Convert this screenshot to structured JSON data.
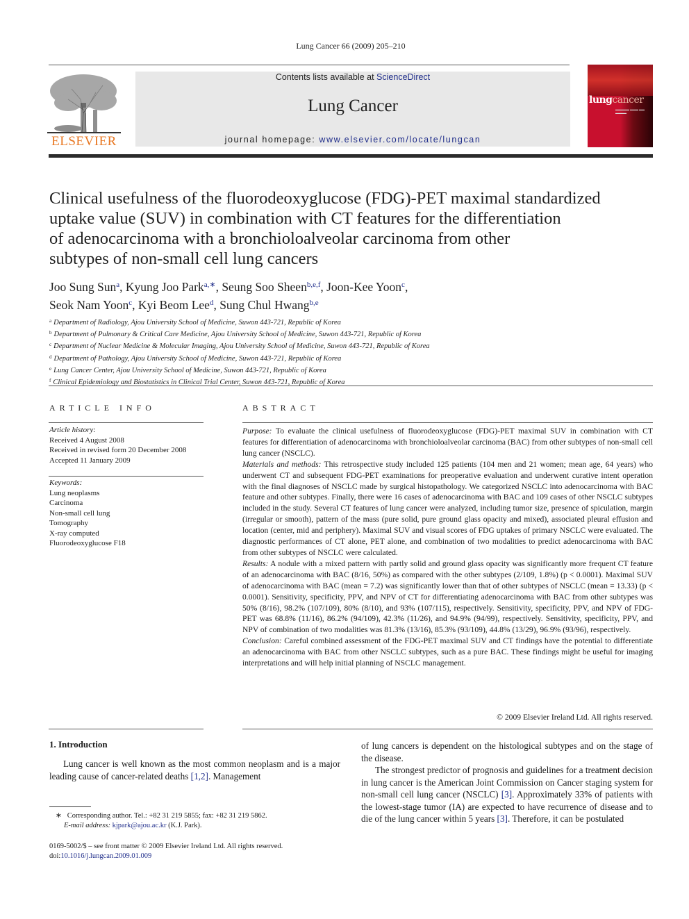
{
  "header": {
    "running_head": "Lung Cancer 66 (2009) 205–210",
    "contents_prefix": "Contents lists available at ",
    "contents_link": "ScienceDirect",
    "journal_title": "Lung Cancer",
    "homepage_prefix": "journal homepage: ",
    "homepage_url": "www.elsevier.com/locate/lungcan",
    "publisher_logo_text": "ELSEVIER",
    "cover": {
      "word1": "lung",
      "word2": "cancer",
      "brand_color": "#c8102e"
    },
    "publisher_color": "#e87722",
    "link_color": "#1f2d8a"
  },
  "article": {
    "title": "Clinical usefulness of the fluorodeoxyglucose (FDG)-PET maximal standardized uptake value (SUV) in combination with CT features for the differentiation of adenocarcinoma with a bronchioloalveolar carcinoma from other subtypes of non-small cell lung cancers",
    "title_lines": [
      "Clinical usefulness of the fluorodeoxyglucose (FDG)-PET maximal standardized",
      "uptake value (SUV) in combination with CT features for the differentiation",
      "of adenocarcinoma with a bronchioloalveolar carcinoma from other",
      "subtypes of non-small cell lung cancers"
    ],
    "authors": [
      {
        "name": "Joo Sung Sun",
        "sup": "a"
      },
      {
        "name": "Kyung Joo Park",
        "sup": "a,∗"
      },
      {
        "name": "Seung Soo Sheen",
        "sup": "b,e,f"
      },
      {
        "name": "Joon-Kee Yoon",
        "sup": "c"
      },
      {
        "name": "Seok Nam Yoon",
        "sup": "c"
      },
      {
        "name": "Kyi Beom Lee",
        "sup": "d"
      },
      {
        "name": "Sung Chul Hwang",
        "sup": "b,e"
      }
    ],
    "affiliations": [
      {
        "key": "a",
        "text": "Department of Radiology, Ajou University School of Medicine, Suwon 443-721, Republic of Korea"
      },
      {
        "key": "b",
        "text": "Department of Pulmonary & Critical Care Medicine, Ajou University School of Medicine, Suwon 443-721, Republic of Korea"
      },
      {
        "key": "c",
        "text": "Department of Nuclear Medicine & Molecular Imaging, Ajou University School of Medicine, Suwon 443-721, Republic of Korea"
      },
      {
        "key": "d",
        "text": "Department of Pathology, Ajou University School of Medicine, Suwon 443-721, Republic of Korea"
      },
      {
        "key": "e",
        "text": "Lung Cancer Center, Ajou University School of Medicine, Suwon 443-721, Republic of Korea"
      },
      {
        "key": "f",
        "text": "Clinical Epidemiology and Biostatistics in Clinical Trial Center, Suwon 443-721, Republic of Korea"
      }
    ]
  },
  "article_info": {
    "label": "ARTICLE INFO",
    "history_head": "Article history:",
    "history": [
      "Received 4 August 2008",
      "Received in revised form 20 December 2008",
      "Accepted 11 January 2009"
    ],
    "keywords_head": "Keywords:",
    "keywords": [
      "Lung neoplasms",
      "Carcinoma",
      "Non-small cell lung",
      "Tomography",
      "X-ray computed",
      "Fluorodeoxyglucose F18"
    ]
  },
  "abstract": {
    "label": "ABSTRACT",
    "sections": [
      {
        "head": "Purpose:",
        "text": " To evaluate the clinical usefulness of fluorodeoxyglucose (FDG)-PET maximal SUV in combination with CT features for differentiation of adenocarcinoma with bronchioloalveolar carcinoma (BAC) from other subtypes of non-small cell lung cancer (NSCLC)."
      },
      {
        "head": "Materials and methods:",
        "text": " This retrospective study included 125 patients (104 men and 21 women; mean age, 64 years) who underwent CT and subsequent FDG-PET examinations for preoperative evaluation and underwent curative intent operation with the final diagnoses of NSCLC made by surgical histopathology. We categorized NSCLC into adenocarcinoma with BAC feature and other subtypes. Finally, there were 16 cases of adenocarcinoma with BAC and 109 cases of other NSCLC subtypes included in the study. Several CT features of lung cancer were analyzed, including tumor size, presence of spiculation, margin (irregular or smooth), pattern of the mass (pure solid, pure ground glass opacity and mixed), associated pleural effusion and location (center, mid and periphery). Maximal SUV and visual scores of FDG uptakes of primary NSCLC were evaluated. The diagnostic performances of CT alone, PET alone, and combination of two modalities to predict adenocarcinoma with BAC from other subtypes of NSCLC were calculated."
      },
      {
        "head": "Results:",
        "text": " A nodule with a mixed pattern with partly solid and ground glass opacity was significantly more frequent CT feature of an adenocarcinoma with BAC (8/16, 50%) as compared with the other subtypes (2/109, 1.8%) (p < 0.0001). Maximal SUV of adenocarcinoma with BAC (mean = 7.2) was significantly lower than that of other subtypes of NSCLC (mean = 13.33) (p < 0.0001). Sensitivity, specificity, PPV, and NPV of CT for differentiating adenocarcinoma with BAC from other subtypes was 50% (8/16), 98.2% (107/109), 80% (8/10), and 93% (107/115), respectively. Sensitivity, specificity, PPV, and NPV of FDG-PET was 68.8% (11/16), 86.2% (94/109), 42.3% (11/26), and 94.9% (94/99), respectively. Sensitivity, specificity, PPV, and NPV of combination of two modalities was 81.3% (13/16), 85.3% (93/109), 44.8% (13/29), 96.9% (93/96), respectively."
      },
      {
        "head": "Conclusion:",
        "text": " Careful combined assessment of the FDG-PET maximal SUV and CT findings have the potential to differentiate an adenocarcinoma with BAC from other NSCLC subtypes, such as a pure BAC. These findings might be useful for imaging interpretations and will help initial planning of NSCLC management."
      }
    ],
    "copyright": "© 2009 Elsevier Ireland Ltd. All rights reserved."
  },
  "body": {
    "intro_heading": "1.  Introduction",
    "left_para_a": "Lung cancer is well known as the most common neoplasm and is a major leading cause of cancer-related deaths ",
    "left_ref_a": "[1,2]",
    "left_para_b": ". Management",
    "right_p1": "of lung cancers is dependent on the histological subtypes and on the stage of the disease.",
    "right_p2_a": "The strongest predictor of prognosis and guidelines for a treatment decision in lung cancer is the American Joint Commission on Cancer staging system for non-small cell lung cancer (NSCLC) ",
    "right_ref_1": "[3]",
    "right_p2_b": ". Approximately 33% of patients with the lowest-stage tumor (IA) are expected to have recurrence of disease and to die of the lung cancer within 5 years ",
    "right_ref_2": "[3]",
    "right_p2_c": ". Therefore, it can be postulated"
  },
  "footnotes": {
    "corresponding_mark": "∗",
    "corresponding": "Corresponding author. Tel.: +82 31 219 5855; fax: +82 31 219 5862.",
    "email_label": "E-mail address:",
    "email": "kjpark@ajou.ac.kr",
    "email_owner": " (K.J. Park).",
    "front_matter": "0169-5002/$ – see front matter © 2009 Elsevier Ireland Ltd. All rights reserved.",
    "doi_prefix": "doi:",
    "doi": "10.1016/j.lungcan.2009.01.009"
  }
}
